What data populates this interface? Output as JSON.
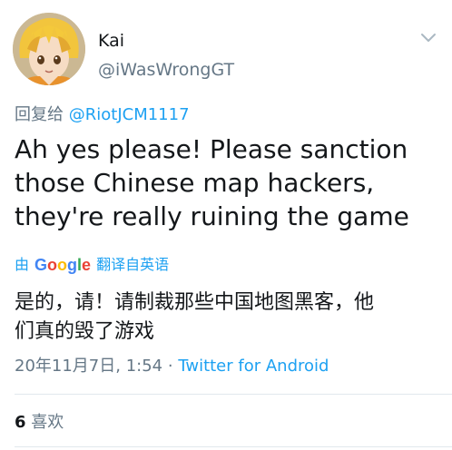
{
  "user": {
    "display_name": "Kai",
    "handle": "@iWasWrongGT",
    "avatar_icon": "anime-avatar"
  },
  "reply": {
    "prefix": "回复给",
    "mention": "@RiotJCM1117"
  },
  "tweet": {
    "text": "Ah yes please! Please sanction\nthose Chinese map hackers,\nthey're really ruining the game"
  },
  "translation": {
    "by_prefix": "由",
    "provider": "Google",
    "by_suffix": "翻译自英语",
    "text": "是的，请！请制裁那些中国地图黑客，他\n们真的毁了游戏"
  },
  "meta": {
    "timestamp": "20年11月7日, 1:54",
    "separator": "·",
    "source": "Twitter for Android"
  },
  "stats": {
    "likes_count": "6",
    "likes_label": "喜欢"
  },
  "colors": {
    "accent": "#1da1f2",
    "secondary_text": "#657786",
    "divider": "#e1e8ed"
  }
}
